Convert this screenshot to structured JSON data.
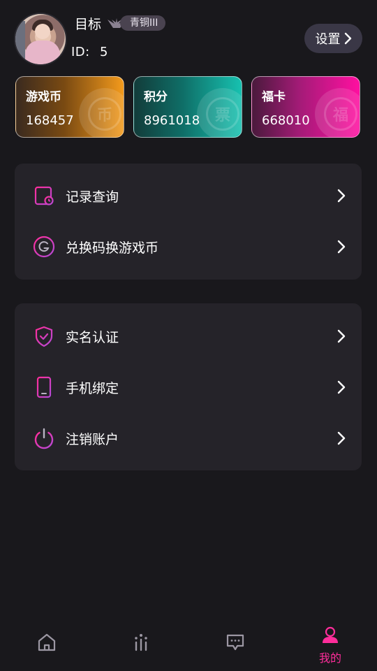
{
  "profile": {
    "username": "目标",
    "rank": "青铜III",
    "id_label": "ID:",
    "id_value": "5",
    "settings_label": "设置"
  },
  "cards": [
    {
      "title": "游戏币",
      "value": "168457",
      "stamp": "币"
    },
    {
      "title": "积分",
      "value": "8961018",
      "stamp": "票"
    },
    {
      "title": "福卡",
      "value": "668010",
      "stamp": "福"
    }
  ],
  "menu_group_1": [
    {
      "label": "记录查询",
      "icon": "record-icon"
    },
    {
      "label": "兑换码换游戏币",
      "icon": "g-coin-icon"
    }
  ],
  "menu_group_2": [
    {
      "label": "实名认证",
      "icon": "shield-check-icon"
    },
    {
      "label": "手机绑定",
      "icon": "phone-icon"
    },
    {
      "label": "注销账户",
      "icon": "power-icon"
    }
  ],
  "nav": {
    "items": [
      {
        "icon": "home-icon"
      },
      {
        "icon": "rank-icon"
      },
      {
        "icon": "message-icon"
      },
      {
        "icon": "user-icon",
        "label": "我的",
        "active": true
      }
    ]
  },
  "colors": {
    "background": "#19181c",
    "panel": "#252329",
    "accent": "#ff2d9b",
    "icon_gradient_start": "#ff2d9b",
    "icon_gradient_end": "#a94bd6"
  }
}
